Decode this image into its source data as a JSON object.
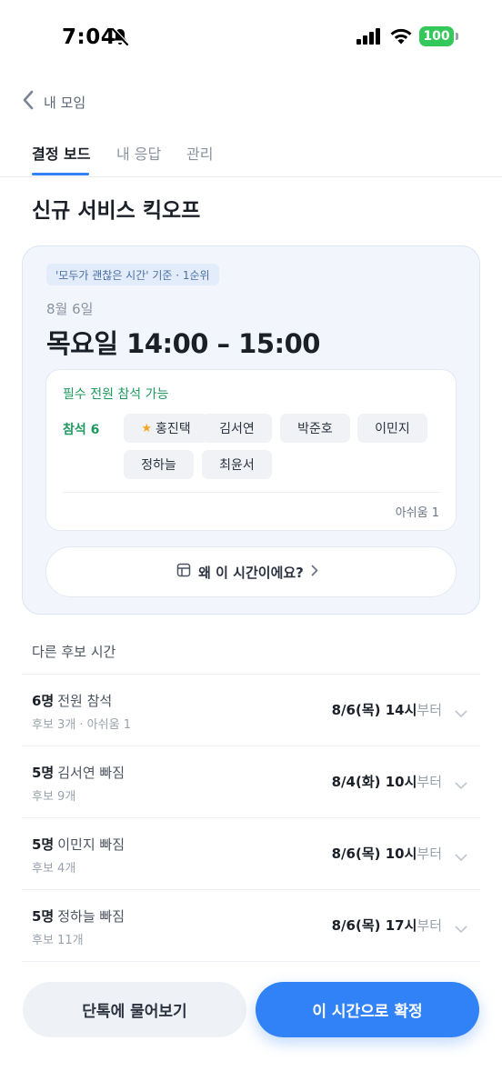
{
  "status_bar": {
    "time": "7:04",
    "battery": "100"
  },
  "nav": {
    "back_label": "내 모임"
  },
  "tabs": [
    {
      "label": "결정 보드",
      "active": true
    },
    {
      "label": "내 응답",
      "active": false
    },
    {
      "label": "관리",
      "active": false
    }
  ],
  "page_title": "신규 서비스 킥오프",
  "recommendation": {
    "badge": "'모두가 괜찮은 시간' 기준 · 1순위",
    "date": "8월 6일",
    "time": "목요일 14:00 – 15:00",
    "required_note": "필수 전원 참석 가능",
    "attend_label": "참석 6",
    "attendees": [
      "홍진택",
      "김서연",
      "박준호",
      "이민지",
      "정하늘",
      "최윤서"
    ],
    "regret": "아쉬움 1",
    "why_button": "왜 이 시간이에요?"
  },
  "candidates_label": "다른 후보 시간",
  "candidates": [
    {
      "count": "6명",
      "desc": "전원 참석",
      "sub": "후보 3개 · 아쉬움 1",
      "date": "8/6(목) 14시",
      "suffix": "부터"
    },
    {
      "count": "5명",
      "desc": "김서연 빠짐",
      "sub": "후보 9개",
      "date": "8/4(화) 10시",
      "suffix": "부터"
    },
    {
      "count": "5명",
      "desc": "이민지 빠짐",
      "sub": "후보 4개",
      "date": "8/6(목) 10시",
      "suffix": "부터"
    },
    {
      "count": "5명",
      "desc": "정하늘 빠짐",
      "sub": "후보 11개",
      "date": "8/6(목) 17시",
      "suffix": "부터"
    }
  ],
  "actions": {
    "ask": "단톡에 물어보기",
    "confirm": "이 시간으로 확정"
  },
  "colors": {
    "accent": "#3182f6",
    "success": "#1f9a5e",
    "star": "#f5a623",
    "battery": "#34c759"
  }
}
